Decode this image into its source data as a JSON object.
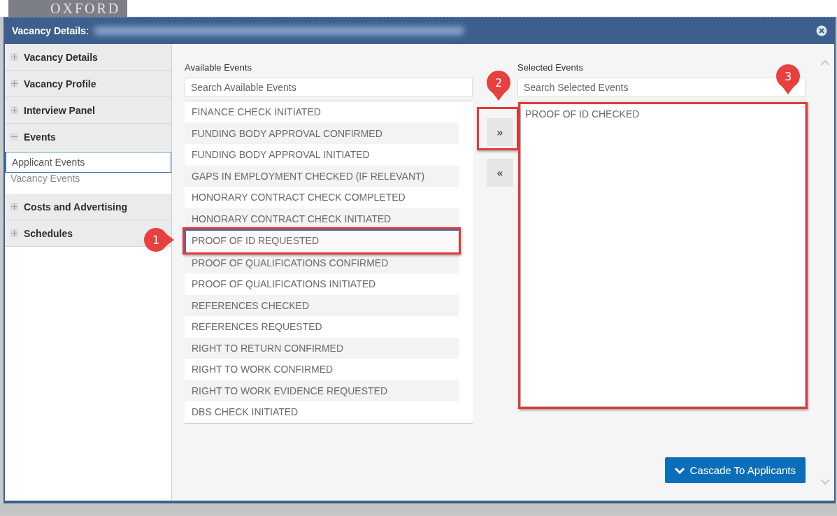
{
  "logo": {
    "text": "OXFORD"
  },
  "window": {
    "title": "Vacancy Details:"
  },
  "sidebar": {
    "items": [
      {
        "label": "Vacancy Details",
        "expanded": false
      },
      {
        "label": "Vacancy Profile",
        "expanded": false
      },
      {
        "label": "Interview Panel",
        "expanded": false
      },
      {
        "label": "Events",
        "expanded": true,
        "children": [
          {
            "label": "Applicant Events",
            "selected": true
          },
          {
            "label": "Vacancy Events",
            "selected": false
          }
        ]
      },
      {
        "label": "Costs and Advertising",
        "expanded": false
      },
      {
        "label": "Schedules",
        "expanded": false
      }
    ]
  },
  "available_events": {
    "label": "Available Events",
    "search": {
      "placeholder": "Search Available Events"
    },
    "items": [
      {
        "label": "FINANCE CHECK INITIATED",
        "selected": false
      },
      {
        "label": "FUNDING BODY APPROVAL CONFIRMED",
        "selected": false
      },
      {
        "label": "FUNDING BODY APPROVAL INITIATED",
        "selected": false
      },
      {
        "label": "GAPS IN EMPLOYMENT CHECKED (IF RELEVANT)",
        "selected": false
      },
      {
        "label": "HONORARY CONTRACT CHECK COMPLETED",
        "selected": false
      },
      {
        "label": "HONORARY CONTRACT CHECK INITIATED",
        "selected": false
      },
      {
        "label": "PROOF OF ID REQUESTED",
        "selected": true,
        "annotation": {
          "label": "1"
        }
      },
      {
        "label": "PROOF OF QUALIFICATIONS CONFIRMED",
        "selected": false
      },
      {
        "label": "PROOF OF QUALIFICATIONS INITIATED",
        "selected": false
      },
      {
        "label": "REFERENCES CHECKED",
        "selected": false
      },
      {
        "label": "REFERENCES REQUESTED",
        "selected": false
      },
      {
        "label": "RIGHT TO RETURN CONFIRMED",
        "selected": false
      },
      {
        "label": "RIGHT TO WORK CONFIRMED",
        "selected": false
      },
      {
        "label": "RIGHT TO WORK EVIDENCE REQUESTED",
        "selected": false
      },
      {
        "label": "DBS CHECK INITIATED",
        "selected": false
      }
    ]
  },
  "move_buttons": [
    {
      "label": "»",
      "annotation": {
        "label": "2"
      }
    },
    {
      "label": "«"
    }
  ],
  "selected_events": {
    "label": "Selected Events",
    "search": {
      "placeholder": "Search Selected Events"
    },
    "items": [
      {
        "label": "PROOF OF ID CHECKED"
      }
    ],
    "annotation": {
      "label": "3"
    }
  },
  "cascade_button": {
    "label": "Cascade To Applicants"
  }
}
